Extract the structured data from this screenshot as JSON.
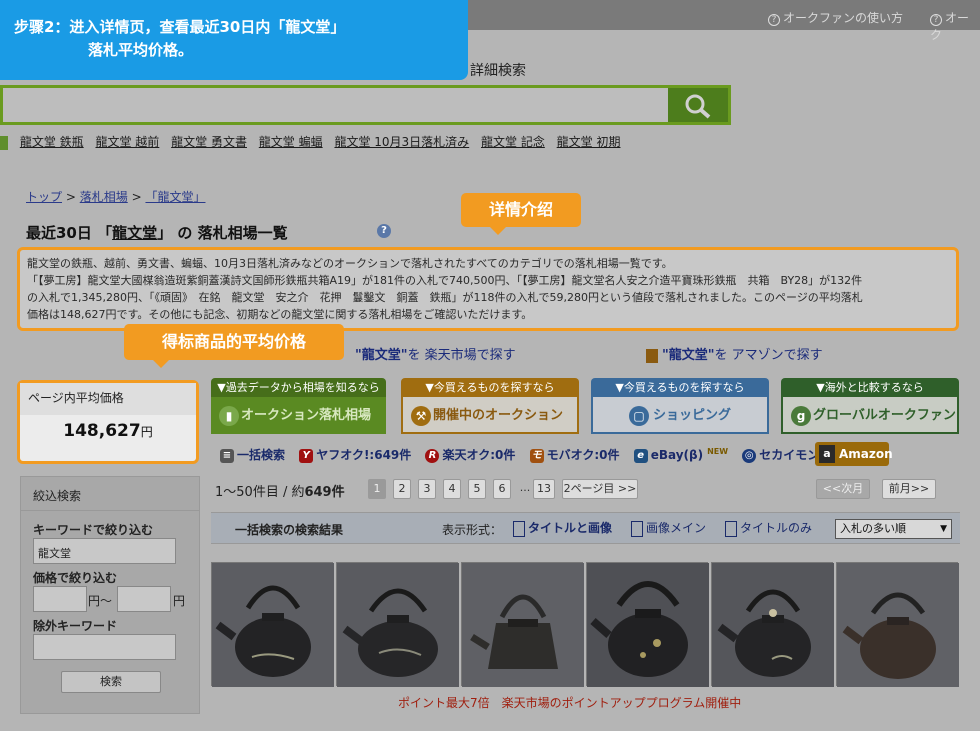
{
  "step_note": {
    "line1": "步骤2：进入详情页，查看最近30日内「龍文堂」",
    "line2": "落札平均价格。"
  },
  "header": {
    "link1": "オークファンの使い方",
    "link2": "オーク"
  },
  "search": {
    "tab_label": "詳細検索",
    "input_value": "",
    "search_icon": "search-icon"
  },
  "keywords": [
    "龍文堂 鉄瓶",
    "龍文堂 越前",
    "龍文堂 勇文書",
    "龍文堂 蝙蝠",
    "龍文堂 10月3日落札済み",
    "龍文堂 記念",
    "龍文堂 初期"
  ],
  "breadcrumb": {
    "home": "トップ",
    "sep1": ">",
    "auction": "落札相場",
    "sep2": ">",
    "current": "「龍文堂」"
  },
  "title": {
    "prefix": "最近30日 「",
    "keyword": "龍文堂",
    "suffix": "」 の 落札相場一覧",
    "help": "?"
  },
  "callouts": {
    "detail": "详情介绍",
    "avg": "得标商品的平均价格"
  },
  "description": {
    "line1": "龍文堂の鉄瓶、越前、勇文書、蝙蝠、10月3日落札済みなどのオークションで落札されたすべてのカテゴリでの落札相場一覧です。",
    "line2": "「【夢工房】龍文堂大國楳翁造斑紫銅蓋漢詩文国師形鉄瓶共箱A19」が181件の入札で740,500円、「【夢工房】龍文堂名人安之介造平寶珠形鉄瓶　共箱　BY28」が132件",
    "line3": "の入札で1,345,280円、「《頑固》　在銘　龍文堂　安之介　花押　鬘鑿文　銅蓋　鉄瓶」が118件の入札で59,280円という値段で落札されました。このページの平均落札",
    "line4": "価格は148,627円です。その他にも記念、初期などの龍文堂に関する落札相場をご確認いただけます。"
  },
  "alt_links": {
    "rakuten_kw": "\"龍文堂\"",
    "rakuten_tail": "を 楽天市場で探す",
    "amazon_kw": "\"龍文堂\"",
    "amazon_tail": "を アマゾンで探す"
  },
  "avg_price": {
    "label": "ページ内平均価格",
    "value": "148,627",
    "unit": "円"
  },
  "panels": [
    {
      "caption": "▼過去データから相場を知るなら",
      "label": "オークション落札相場",
      "icon": "chart-icon"
    },
    {
      "caption": "▼今買えるものを探すなら",
      "label": "開催中のオークション",
      "icon": "hammer-icon"
    },
    {
      "caption": "▼今買えるものを探すなら",
      "label": "ショッピング",
      "icon": "lock-icon"
    },
    {
      "caption": "▼海外と比較するなら",
      "label": "グローバルオークファン",
      "icon": "globe-icon"
    }
  ],
  "source_links": [
    {
      "label": "一括検索"
    },
    {
      "label": "ヤフオク!:649件"
    },
    {
      "label": "楽天オク:0件"
    },
    {
      "label": "モバオク:0件"
    },
    {
      "label": "eBay(β)"
    },
    {
      "label": "NEW"
    },
    {
      "label": "セカイモン"
    },
    {
      "label": "Amazon"
    }
  ],
  "pagination": {
    "summary": "1〜50件目 / 約",
    "total": "649件",
    "pages": [
      "1",
      "2",
      "3",
      "4",
      "5",
      "6",
      "...",
      "13"
    ],
    "next_label": "2ページ目 >>",
    "prev_page": "<<次月",
    "prev_month": "前月>>"
  },
  "results": {
    "header": "一括検索の検索結果",
    "format_label": "表示形式：",
    "opt1": "タイトルと画像",
    "opt2": "画像メイン",
    "opt3": "タイトルのみ",
    "sort": "入札の多い順"
  },
  "sidebar": {
    "title": "絞込検索",
    "kw_label": "キーワードで絞り込む",
    "kw_value": "龍文堂",
    "price_label": "価格で絞り込む",
    "yen1": "円〜",
    "yen2": "円",
    "exclude_label": "除外キーワード",
    "exclude_value": "",
    "search_btn": "検索"
  },
  "promo": "ポイント最大7倍　楽天市場のポイントアッププログラム開催中",
  "colors": {
    "accent": "#f29b21",
    "step_blue": "#1a9be5",
    "green": "#6a9b1f"
  }
}
